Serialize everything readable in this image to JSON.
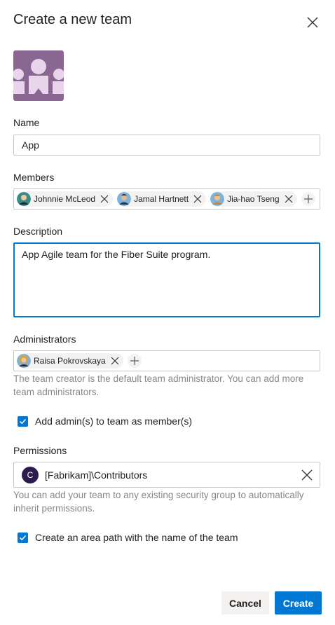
{
  "dialog": {
    "title": "Create a new team",
    "close_icon": "close-icon",
    "team_image_icon": "team-image"
  },
  "name": {
    "label": "Name",
    "value": "App"
  },
  "members": {
    "label": "Members",
    "people": [
      {
        "name": "Johnnie McLeod",
        "avatar_color": "#3b8a8a"
      },
      {
        "name": "Jamal Hartnett",
        "avatar_color": "#2d6a8e"
      },
      {
        "name": "Jia-hao Tseng",
        "avatar_color": "#d9822b"
      }
    ],
    "add_icon": "plus-icon"
  },
  "description": {
    "label": "Description",
    "value": "App Agile team for the Fiber Suite program."
  },
  "administrators": {
    "label": "Administrators",
    "people": [
      {
        "name": "Raisa Pokrovskaya",
        "avatar_color": "#e0a030"
      }
    ],
    "add_icon": "plus-icon",
    "helper": "The team creator is the default team administrator. You can add more team administrators."
  },
  "add_admins_checkbox": {
    "label": "Add admin(s) to team as member(s)",
    "checked": true
  },
  "permissions": {
    "label": "Permissions",
    "group_initial": "C",
    "group_name": "[Fabrikam]\\Contributors",
    "helper": "You can add your team to any existing security group to automatically inherit permissions."
  },
  "area_path_checkbox": {
    "label": "Create an area path with the name of the team",
    "checked": true
  },
  "buttons": {
    "cancel": "Cancel",
    "create": "Create"
  },
  "colors": {
    "accent": "#0078d4",
    "team_image": "#8a6692"
  }
}
